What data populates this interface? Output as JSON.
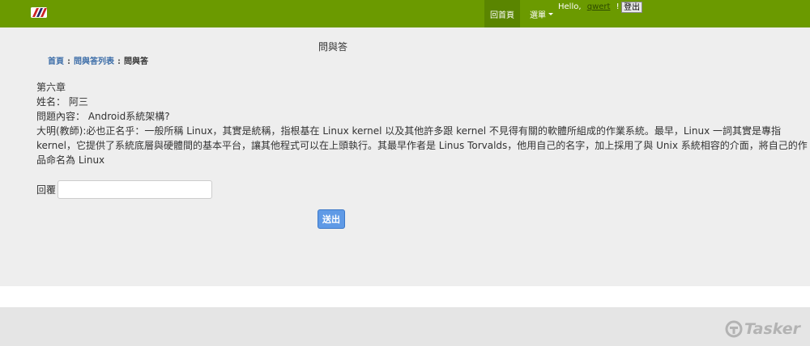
{
  "nav": {
    "home_label": "回首頁",
    "menu_label": "選單",
    "greeting_prefix": "Hello,",
    "username": "qwert",
    "greeting_suffix": "!",
    "logout_label": "登出"
  },
  "page": {
    "title": "問與答"
  },
  "breadcrumb": {
    "items": [
      "首頁",
      "問與答列表",
      "問與答"
    ],
    "separator": ":"
  },
  "question": {
    "chapter": "第六章",
    "name_line": "姓名： 阿三",
    "content_line": "問題內容： Android系統架構?",
    "answer": "大明(教師):必也正名乎：一般所稱 Linux，其實是統稱，指根基在 Linux kernel 以及其他許多跟 kernel 不見得有關的軟體所組成的作業系統。最早，Linux 一詞其實是專指 kernel，它提供了系統底層與硬體間的基本平台，讓其他程式可以在上頭執行。其最早作者是 Linus Torvalds，他用自己的名字，加上採用了與 Unix 系統相容的介面，將自己的作品命名為 Linux"
  },
  "reply": {
    "label": "回覆",
    "value": "",
    "submit_label": "送出"
  },
  "watermark": {
    "text": "Tasker"
  },
  "colors": {
    "navbar": "#6b9a00",
    "navbar_active": "#5a8500",
    "main_bg": "#eeeeee",
    "link": "#3d6ea8",
    "button": "#5f9ae6"
  }
}
